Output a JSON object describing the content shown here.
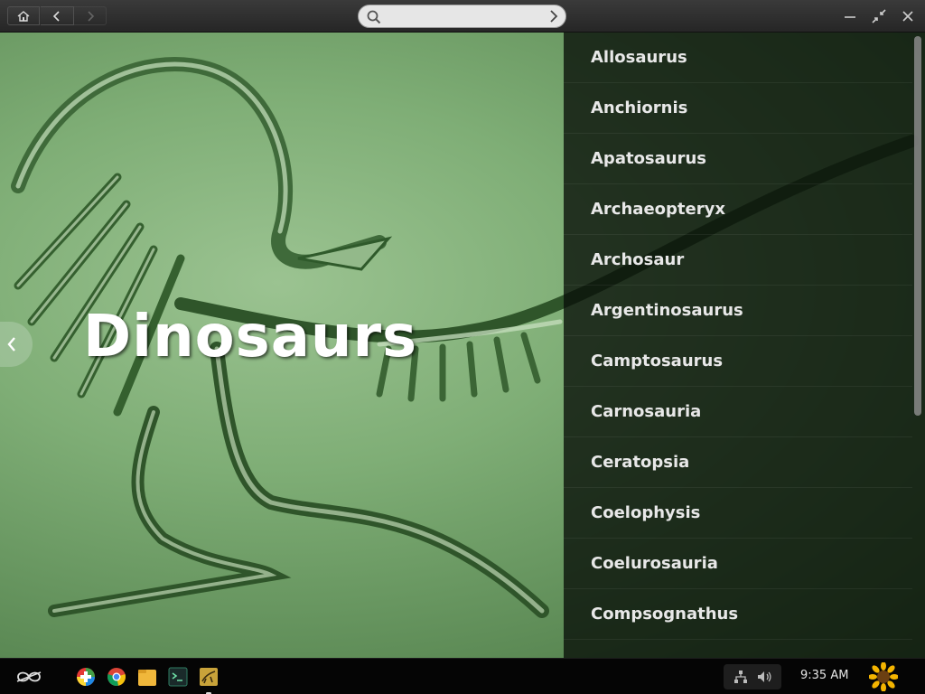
{
  "search": {
    "placeholder": "",
    "value": ""
  },
  "hero": {
    "title": "Dinosaurs"
  },
  "list": {
    "items": [
      "Allosaurus",
      "Anchiornis",
      "Apatosaurus",
      "Archaeopteryx",
      "Archosaur",
      "Argentinosaurus",
      "Camptosaurus",
      "Carnosauria",
      "Ceratopsia",
      "Coelophysis",
      "Coelurosauria",
      "Compsognathus"
    ]
  },
  "taskbar": {
    "apps": [
      "app-store-icon",
      "chrome-icon",
      "files-icon",
      "terminal-icon",
      "dinosaurs-app-icon"
    ],
    "clock": "9:35 AM"
  },
  "colors": {
    "accent_green": "#7fae76",
    "panel_dark": "#0b130b",
    "list_text": "#e8e8e8"
  }
}
